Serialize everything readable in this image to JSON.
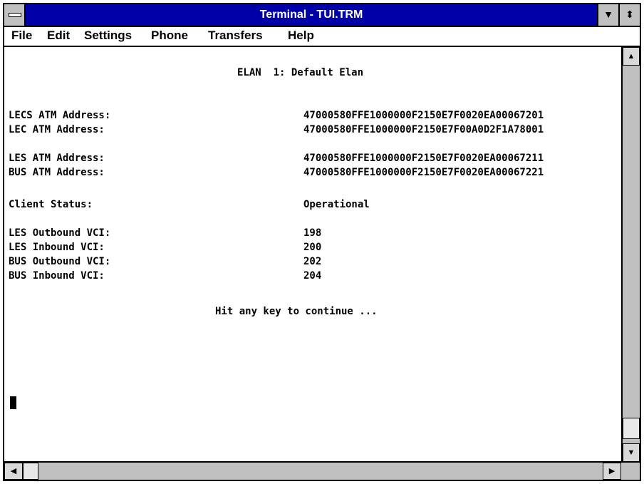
{
  "window": {
    "title": "Terminal - TUI.TRM"
  },
  "menu": [
    "File",
    "Edit",
    "Settings",
    "Phone",
    "Transfers",
    "Help"
  ],
  "terminal": {
    "heading": "ELAN  1: Default Elan",
    "lecs_label": "LECS ATM Address:",
    "lecs_value": "47000580FFE1000000F2150E7F0020EA00067201",
    "lec_label": "LEC ATM Address:",
    "lec_value": "47000580FFE1000000F2150E7F00A0D2F1A78001",
    "les_label": "LES ATM Address:",
    "les_value": "47000580FFE1000000F2150E7F0020EA00067211",
    "bus_label": "BUS ATM Address:",
    "bus_value": "47000580FFE1000000F2150E7F0020EA00067221",
    "status_label": "Client Status:",
    "status_value": "Operational",
    "les_out_label": "LES Outbound VCI:",
    "les_out_value": "198",
    "les_in_label": "LES Inbound VCI:",
    "les_in_value": "200",
    "bus_out_label": "BUS Outbound VCI:",
    "bus_out_value": "202",
    "bus_in_label": "BUS Inbound VCI:",
    "bus_in_value": "204",
    "prompt": "Hit any key to continue ..."
  },
  "icons": {
    "system_menu": "system-menu-icon",
    "minimize": "minimize-icon",
    "maximize": "maximize-icon",
    "scroll_up": "arrow-up-icon",
    "scroll_down": "arrow-down-icon",
    "scroll_left": "arrow-left-icon",
    "scroll_right": "arrow-right-icon"
  },
  "colors": {
    "titlebar": "#0000a8",
    "chrome": "#c0c0c0",
    "text": "#000000"
  }
}
